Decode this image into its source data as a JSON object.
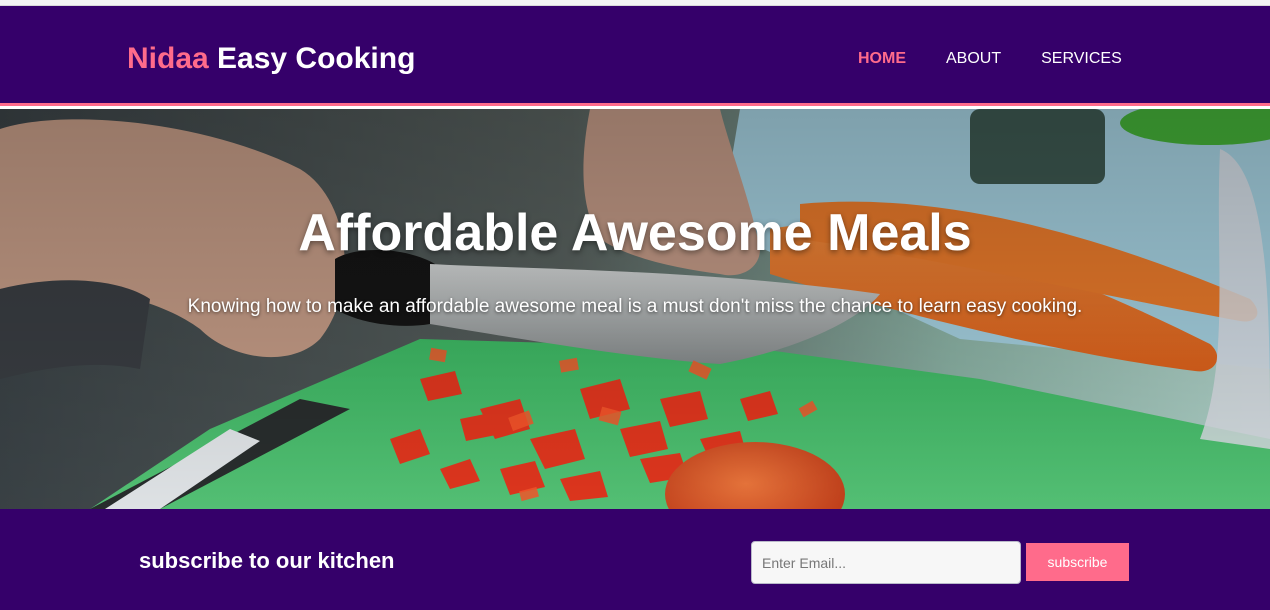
{
  "brand": {
    "highlight": "Nidaa",
    "rest": " Easy Cooking",
    "highlight_color": "#ff6b8b"
  },
  "nav": {
    "items": [
      {
        "label": "Home",
        "active": true
      },
      {
        "label": "About",
        "active": false
      },
      {
        "label": "Services",
        "active": false
      }
    ]
  },
  "hero": {
    "title": "Affordable Awesome Meals",
    "text": "Knowing how to make an affordable awesome meal is a must don't miss the chance to learn easy cooking.",
    "image_subject": "hands-chopping-red-pepper-carrots-cutting-board"
  },
  "subscribe": {
    "heading": "subscribe to our kitchen",
    "email_placeholder": "Enter Email...",
    "button_label": "subscribe"
  },
  "colors": {
    "primary": "#35006a",
    "accent": "#ff6b8b",
    "text": "#ffffff"
  }
}
